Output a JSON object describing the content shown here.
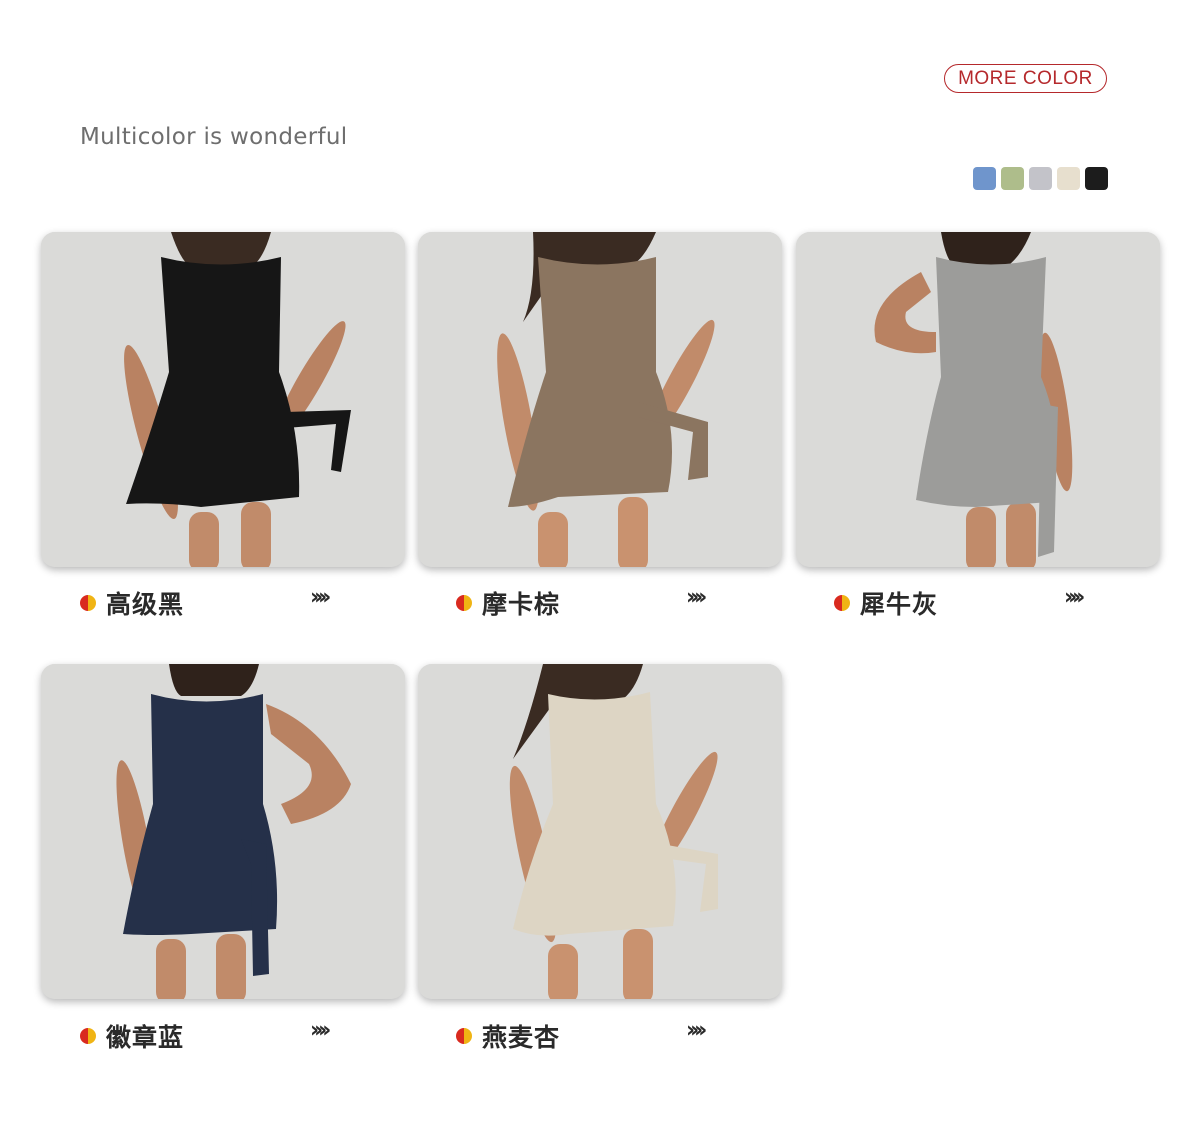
{
  "header": {
    "more_color": "MORE COLOR",
    "subtitle": "Multicolor is wonderful",
    "swatches": [
      {
        "name": "blue-swatch",
        "color": "#6f95cc"
      },
      {
        "name": "green-swatch",
        "color": "#aebd8b"
      },
      {
        "name": "grey-swatch",
        "color": "#c3c3c9"
      },
      {
        "name": "cream-swatch",
        "color": "#e7dfce"
      },
      {
        "name": "black-swatch",
        "color": "#1c1c1c"
      }
    ]
  },
  "products": [
    {
      "label": "高级黑",
      "arrows": "››››",
      "dress_color": "#161616"
    },
    {
      "label": "摩卡棕",
      "arrows": "››››",
      "dress_color": "#8b7560"
    },
    {
      "label": "犀牛灰",
      "arrows": "››››",
      "dress_color": "#9c9c9a"
    },
    {
      "label": "徽章蓝",
      "arrows": "››››",
      "dress_color": "#253049"
    },
    {
      "label": "燕麦杏",
      "arrows": "››››",
      "dress_color": "#ddd5c4"
    }
  ]
}
